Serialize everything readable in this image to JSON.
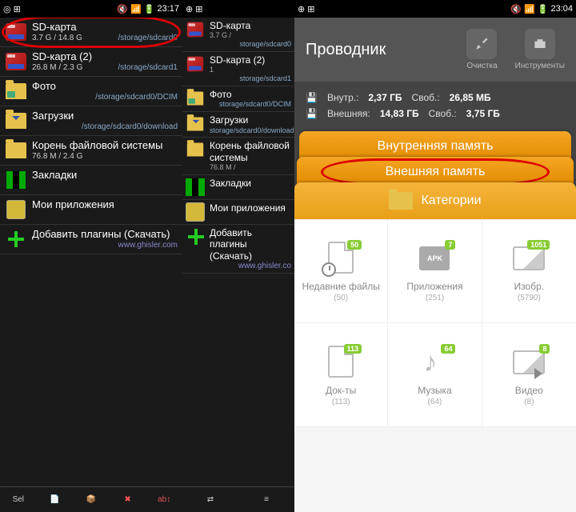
{
  "status1": {
    "time": "23:17"
  },
  "status2": {
    "time": "23:04"
  },
  "tc": {
    "items": [
      {
        "title": "SD-карта",
        "size": "3.7 G / 14.8 G",
        "path": "/storage/sdcard0"
      },
      {
        "title": "SD-карта (2)",
        "size": "26.8 M / 2.3 G",
        "path": "/storage/sdcard1"
      },
      {
        "title": "Фото",
        "size": "",
        "path": "/storage/sdcard0/DCIM"
      },
      {
        "title": "Загрузки",
        "size": "",
        "path": "/storage/sdcard0/download"
      },
      {
        "title": "Корень файловой системы",
        "size": "76.8 M / 2.4 G",
        "path": ""
      },
      {
        "title": "Закладки",
        "size": "",
        "path": ""
      },
      {
        "title": "Мои приложения",
        "size": "",
        "path": ""
      },
      {
        "title": "Добавить плагины (Скачать)",
        "size": "",
        "path": "www.ghisler.com"
      }
    ]
  },
  "tc2": {
    "items": [
      {
        "title": "SD-карта",
        "size": "3.7 G /",
        "path": "storage/sdcard0"
      },
      {
        "title": "SD-карта (2)",
        "size": "1",
        "path": "storage/sdcard1"
      },
      {
        "title": "Фото",
        "size": "",
        "path": "storage/sdcard0/DCIM"
      },
      {
        "title": "Загрузки",
        "size": "",
        "path": "storage/sdcard0/download"
      },
      {
        "title": "Корень файловой системы",
        "size": "76.8 M /",
        "path": ""
      },
      {
        "title": "Закладки",
        "size": "",
        "path": ""
      },
      {
        "title": "Мои приложения",
        "size": "",
        "path": ""
      },
      {
        "title": "Добавить плагины (Скачать)",
        "size": "",
        "path": "www.ghisler.co"
      }
    ]
  },
  "cond": {
    "title": "Проводник",
    "actions": {
      "clean": "Очистка",
      "tools": "Инструменты"
    },
    "storage": {
      "internal_lbl": "Внутр.:",
      "internal_val": "2,37 ГБ",
      "internal_free_lbl": "Своб.:",
      "internal_free": "26,85 МБ",
      "external_lbl": "Внешняя:",
      "external_val": "14,83 ГБ",
      "external_free_lbl": "Своб.:",
      "external_free": "3,75 ГБ"
    },
    "tabs": {
      "t1": "Внутренняя память",
      "t2": "Внешняя память",
      "t3": "Категории"
    },
    "grid": [
      {
        "label": "Недавние файлы",
        "count": "(50)",
        "badge": "50"
      },
      {
        "label": "Приложения",
        "count": "(251)",
        "badge": "7"
      },
      {
        "label": "Изобр.",
        "count": "(5790)",
        "badge": "1051"
      },
      {
        "label": "Док-ты",
        "count": "(113)",
        "badge": "113"
      },
      {
        "label": "Музыка",
        "count": "(64)",
        "badge": "64"
      },
      {
        "label": "Видео",
        "count": "(8)",
        "badge": "8"
      }
    ]
  }
}
